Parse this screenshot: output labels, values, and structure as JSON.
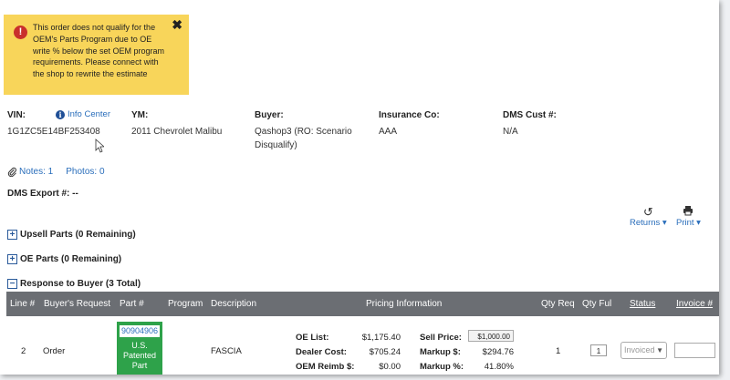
{
  "alert": {
    "message": "This order does not qualify for the OEM's Parts Program due to OE write % below the set OEM program requirements. Please connect with the shop to rewrite the estimate",
    "close": "✖"
  },
  "vin": {
    "label": "VIN:",
    "value": "1G1ZC5E14BF253408",
    "info_center": "Info Center"
  },
  "ym": {
    "label": "YM:",
    "value": "2011 Chevrolet Malibu"
  },
  "buyer": {
    "label": "Buyer:",
    "line1": "Qashop3 (RO: Scenario",
    "line2": "Disqualify)"
  },
  "insurance": {
    "label": "Insurance Co:",
    "value": "AAA"
  },
  "dms_cust": {
    "label": "DMS Cust #:",
    "value": "N/A"
  },
  "notes": "Notes: 1",
  "photos": "Photos: 0",
  "dms_export": "DMS Export #: --",
  "actions": {
    "returns": "Returns ▾",
    "print": "Print ▾"
  },
  "sections": {
    "upsell": "Upsell Parts (0 Remaining)",
    "oe": "OE Parts (0 Remaining)",
    "response": "Response to Buyer (3 Total)"
  },
  "table": {
    "headers": {
      "line": "Line #",
      "request": "Buyer's Request",
      "part": "Part #",
      "program": "Program",
      "description": "Description",
      "pricing": "Pricing Information",
      "qty_req": "Qty Req",
      "qty_ful": "Qty Ful",
      "status": "Status",
      "invoice": "Invoice #"
    },
    "rows": [
      {
        "line": "2",
        "request": "Order",
        "part_number": "90904906",
        "part_tag_1": "U.S.",
        "part_tag_2": "Patented",
        "part_tag_3": "Part",
        "description": "FASCIA",
        "oe_list_label": "OE List:",
        "oe_list": "$1,175.40",
        "dealer_cost_label": "Dealer Cost:",
        "dealer_cost": "$705.24",
        "oem_reimb_label": "OEM Reimb $:",
        "oem_reimb": "$0.00",
        "sell_price_label": "Sell Price:",
        "sell_price": "$1,000.00",
        "markup_label": "Markup $:",
        "markup": "$294.76",
        "markup_pct_label": "Markup %:",
        "markup_pct": "41.80%",
        "qty_req": "1",
        "qty_ful": "1",
        "status": "Invoiced",
        "invoice": ""
      }
    ]
  },
  "colors": {
    "alert_bg": "#f8d55a",
    "header_bg": "#6b6e73",
    "part_green": "#2ea24a",
    "link": "#2a6ebb"
  }
}
